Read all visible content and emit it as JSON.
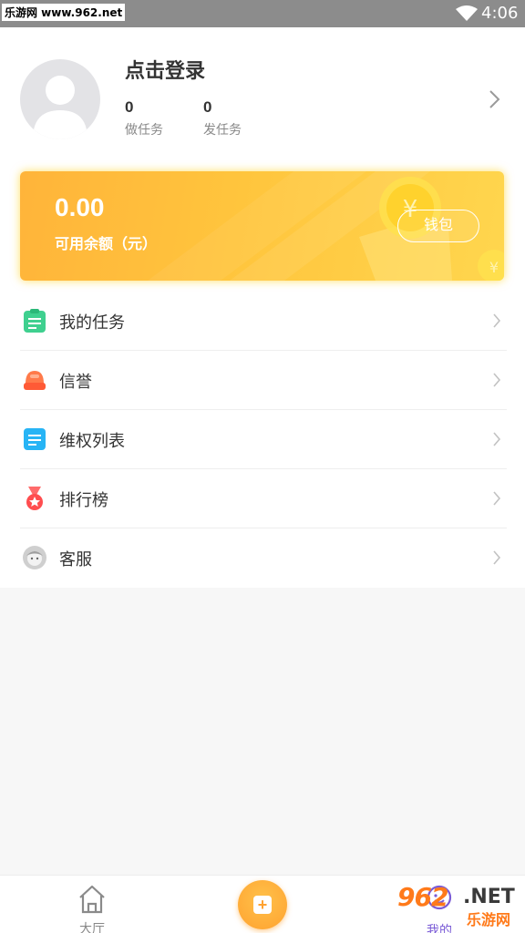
{
  "status_bar": {
    "watermark": "乐游网 www.962.net",
    "time": "4:06"
  },
  "profile": {
    "login_text": "点击登录",
    "stats": [
      {
        "value": "0",
        "label": "做任务"
      },
      {
        "value": "0",
        "label": "发任务"
      }
    ]
  },
  "wallet": {
    "amount": "0.00",
    "amount_label": "可用余额（元）",
    "button_label": "钱包",
    "colors": {
      "start": "#ffb43a",
      "end": "#ffd64e"
    }
  },
  "menu": {
    "items": [
      {
        "label": "我的任务",
        "icon": "clipboard-icon"
      },
      {
        "label": "信誉",
        "icon": "helmet-icon"
      },
      {
        "label": "维权列表",
        "icon": "document-icon"
      },
      {
        "label": "排行榜",
        "icon": "medal-icon"
      },
      {
        "label": "客服",
        "icon": "customer-service-icon"
      }
    ]
  },
  "bottom_nav": {
    "home_label": "大厅",
    "mine_label": "我的"
  },
  "watermark": {
    "brand_number": "962",
    "brand_suffix": ".NET",
    "site_name": "乐游网"
  }
}
